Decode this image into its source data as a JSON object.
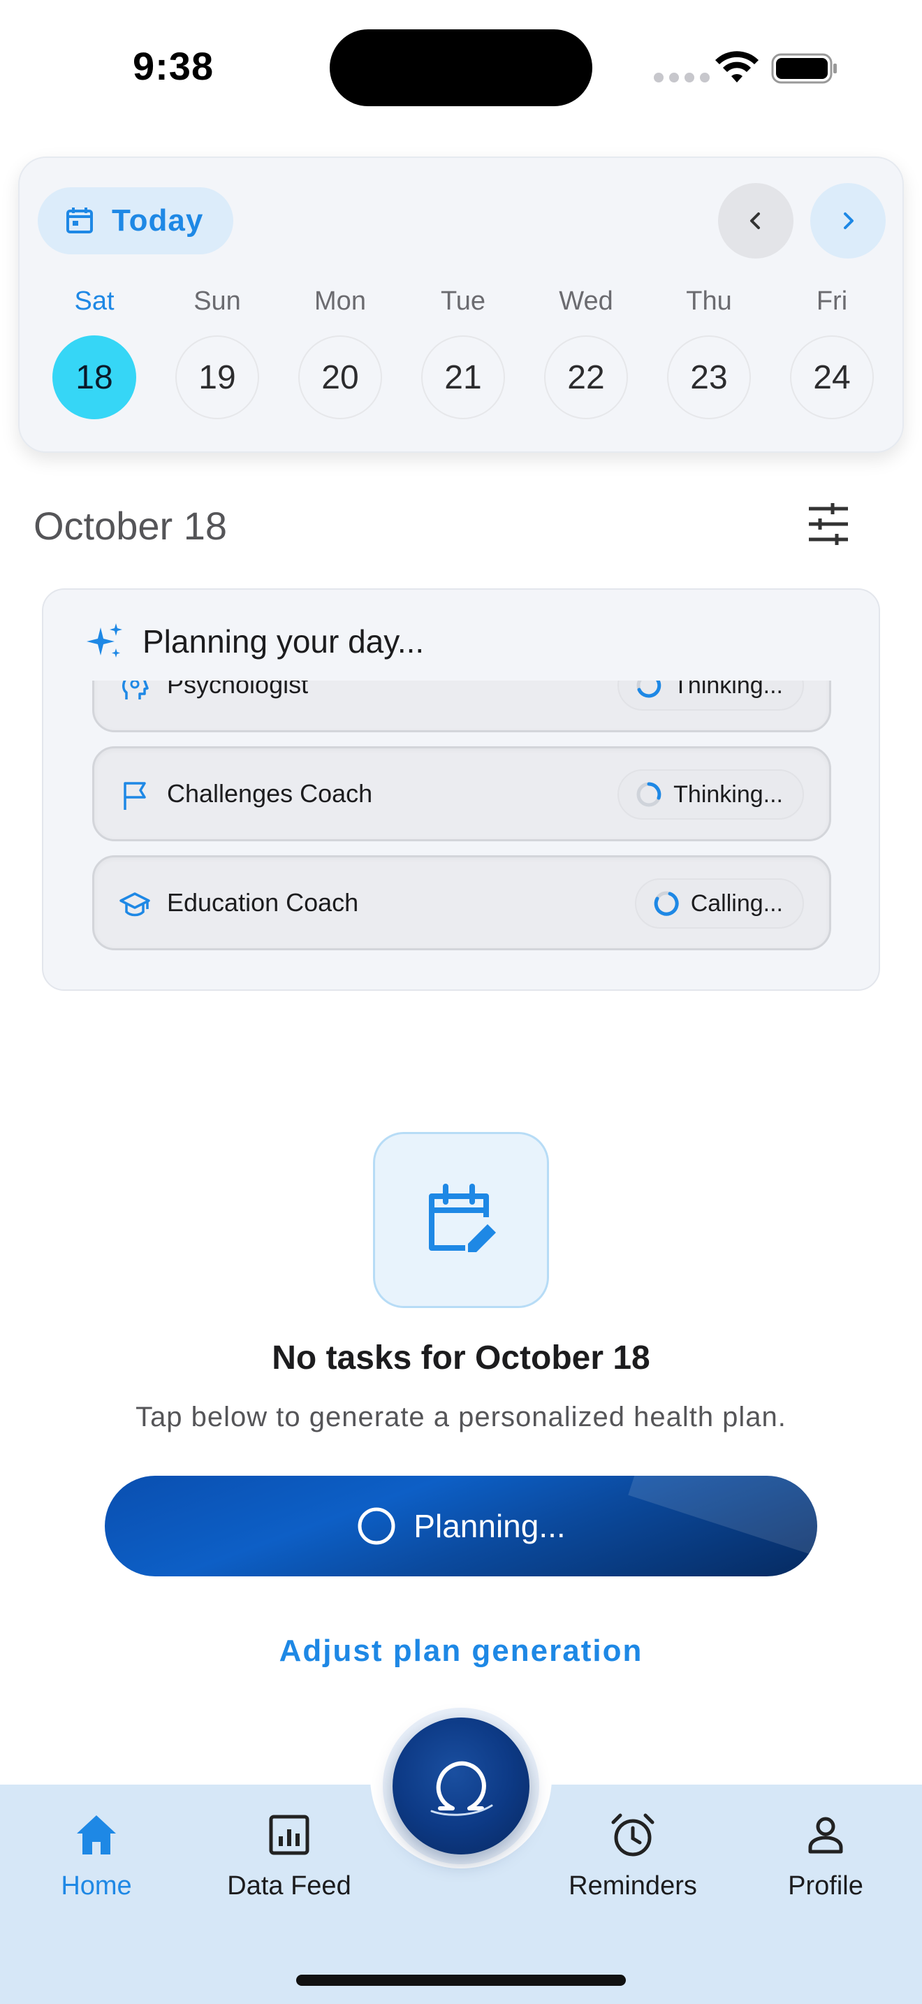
{
  "status_bar": {
    "time": "9:38"
  },
  "calendar": {
    "today_label": "Today",
    "days": [
      {
        "name": "Sat",
        "num": "18",
        "selected": true
      },
      {
        "name": "Sun",
        "num": "19"
      },
      {
        "name": "Mon",
        "num": "20"
      },
      {
        "name": "Tue",
        "num": "21"
      },
      {
        "name": "Wed",
        "num": "22"
      },
      {
        "name": "Thu",
        "num": "23"
      },
      {
        "name": "Fri",
        "num": "24"
      }
    ]
  },
  "date_heading": "October 18",
  "planning": {
    "title": "Planning your day...",
    "agents": [
      {
        "name": "Psychologist",
        "status": "Thinking...",
        "icon": "brain-head-icon"
      },
      {
        "name": "Challenges Coach",
        "status": "Thinking...",
        "icon": "flag-icon"
      },
      {
        "name": "Education Coach",
        "status": "Calling...",
        "icon": "graduation-cap-icon"
      }
    ]
  },
  "empty_state": {
    "title": "No tasks for October 18",
    "subtitle": "Tap below to generate a personalized health plan.",
    "button_label": "Planning...",
    "adjust_link": "Adjust plan generation"
  },
  "bottom_nav": {
    "items": [
      {
        "label": "Home",
        "icon": "home-icon",
        "active": true
      },
      {
        "label": "Data Feed",
        "icon": "chart-box-icon"
      },
      {
        "label": "Reminders",
        "icon": "alarm-clock-icon"
      },
      {
        "label": "Profile",
        "icon": "person-icon"
      }
    ]
  },
  "colors": {
    "accent": "#1e88e5",
    "selected_day": "#36d6f6",
    "button_dark": "#0a4fb0",
    "nav_bg": "#d6e7f7"
  }
}
